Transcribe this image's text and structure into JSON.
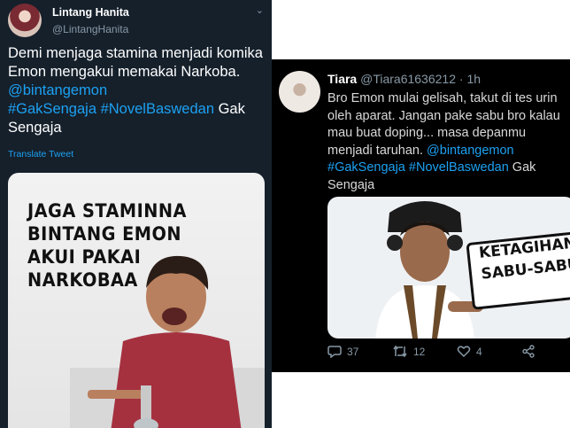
{
  "left_tweet": {
    "author_name": "Lintang Hanita",
    "author_handle": "@LintangHanita",
    "text_plain": "Demi menjaga stamina menjadi komika Emon mengakui memakai Narkoba. ",
    "mention": "@bintangemon",
    "hashtag_1": "#GakSengaja",
    "hashtag_2": "#NovelBaswedan",
    "text_tail": " Gak Sengaja",
    "translate_label": "Translate Tweet",
    "meme_text": "JAGA STAMINNA BINTANG EMON AKUI PAKAI NARKOBAA"
  },
  "right_tweet": {
    "author_name": "Tiara",
    "author_handle": "@Tiara61636212",
    "separator": " · ",
    "time": "1h",
    "text_plain": "Bro Emon mulai gelisah, takut di tes urin oleh aparat. Jangan pake sabu bro kalau mau buat doping... masa depanmu menjadi taruhan. ",
    "mention": "@bintangemon",
    "hashtag_1": "#GakSengaja",
    "hashtag_2": "#NovelBaswedan",
    "text_tail": " Gak Sengaja",
    "meme_text": "KETAGIHAN SABU-SABU",
    "actions": {
      "reply_count": "37",
      "retweet_count": "12",
      "like_count": "4"
    }
  },
  "colors": {
    "left_bg": "#15202b",
    "right_bg": "#000000",
    "link": "#1da1f2",
    "muted": "#8899a6"
  },
  "icons": [
    "chevron-down-icon",
    "reply-icon",
    "retweet-icon",
    "like-icon",
    "share-icon"
  ]
}
